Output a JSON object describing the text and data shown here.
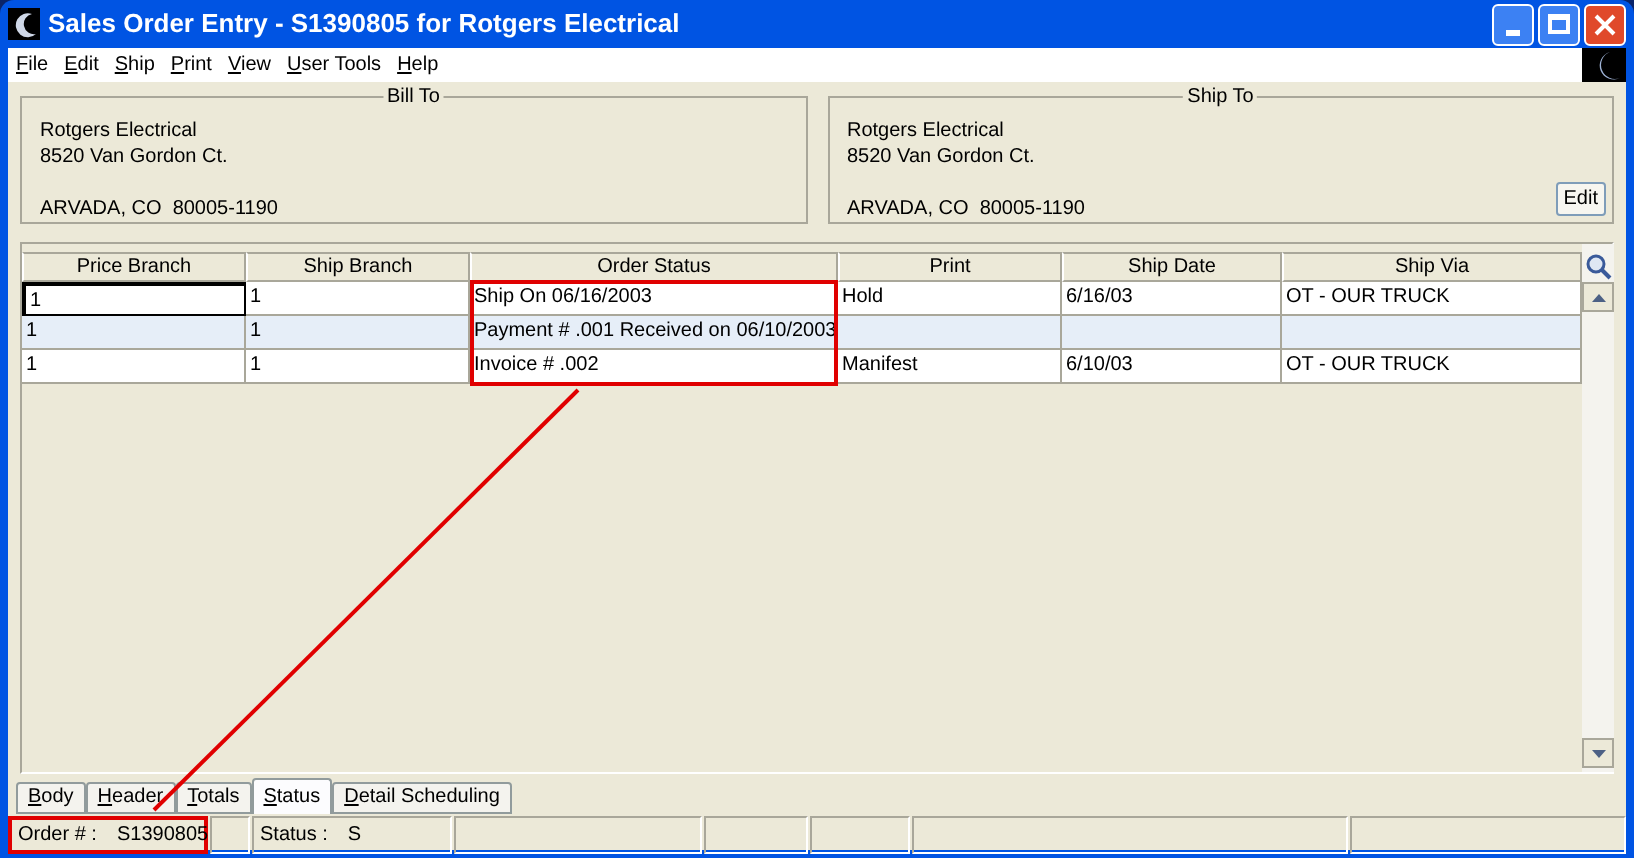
{
  "window": {
    "title": "Sales Order Entry - S1390805 for Rotgers Electrical"
  },
  "menu": [
    "File",
    "Edit",
    "Ship",
    "Print",
    "View",
    "User Tools",
    "Help"
  ],
  "bill_to": {
    "title": "Bill To",
    "lines": [
      "Rotgers Electrical",
      "8520 Van Gordon Ct."
    ],
    "city_line": "ARVADA, CO  80005-1190"
  },
  "ship_to": {
    "title": "Ship To",
    "lines": [
      "Rotgers Electrical",
      "8520 Van Gordon Ct."
    ],
    "city_line": "ARVADA, CO  80005-1190",
    "button": "Edit"
  },
  "table": {
    "columns": [
      {
        "label": "Price Branch",
        "highlighted": false
      },
      {
        "label": "Ship Branch",
        "highlighted": false
      },
      {
        "label": "Order Status",
        "highlighted": true
      },
      {
        "label": "Print",
        "highlighted": false
      },
      {
        "label": "Ship Date",
        "highlighted": false
      },
      {
        "label": "Ship Via",
        "highlighted": false
      }
    ],
    "rows": [
      {
        "cells": [
          "1",
          "1",
          "Ship On 06/16/2003",
          "Hold",
          "6/16/03",
          "OT - OUR TRUCK"
        ],
        "selected": false,
        "focused": true
      },
      {
        "cells": [
          "1",
          "1",
          "Payment # .001 Received on 06/10/2003",
          "",
          "",
          ""
        ],
        "selected": true,
        "focused": false
      },
      {
        "cells": [
          "1",
          "1",
          "Invoice # .002",
          "Manifest",
          "6/10/03",
          "OT - OUR TRUCK"
        ],
        "selected": false,
        "focused": false
      }
    ]
  },
  "tabs": [
    {
      "label": "Body",
      "selected": false
    },
    {
      "label": "Header",
      "selected": false
    },
    {
      "label": "Totals",
      "selected": false
    },
    {
      "label": "Status",
      "selected": true
    },
    {
      "label": "Detail Scheduling",
      "selected": false
    }
  ],
  "status_bar": [
    {
      "label": "Order # :",
      "value": "S1390805",
      "highlighted": true
    },
    {
      "label": "Status :",
      "value": "S",
      "highlighted": false
    }
  ]
}
